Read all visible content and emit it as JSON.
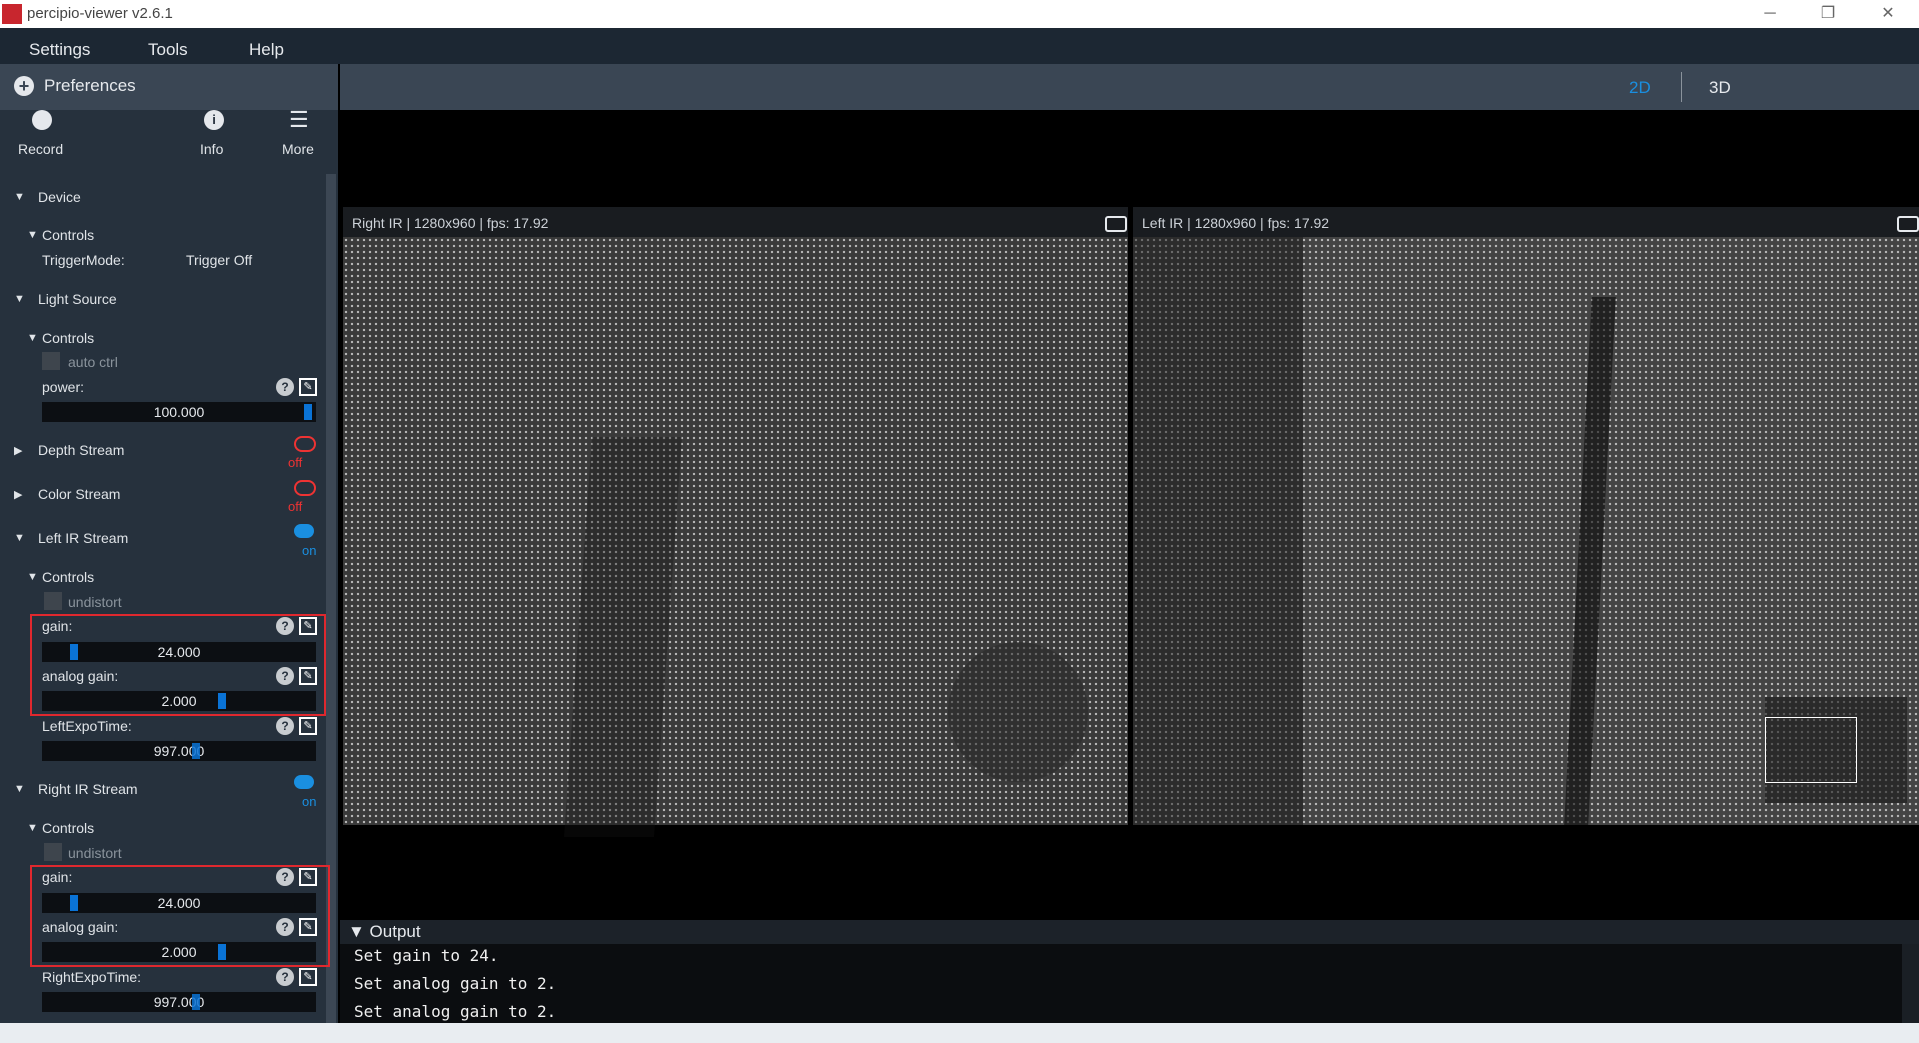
{
  "window": {
    "title": "percipio-viewer v2.6.1",
    "minimize": "─",
    "restore": "❐",
    "close": "✕"
  },
  "menu": {
    "settings": "Settings",
    "tools": "Tools",
    "help": "Help"
  },
  "sidebar": {
    "preferences": "Preferences",
    "plus": "+",
    "record": "Record",
    "info": "Info",
    "info_glyph": "i",
    "more": "More",
    "more_glyph": "☰",
    "device": "Device",
    "controls": "Controls",
    "trigger_mode_label": "TriggerMode:",
    "trigger_mode_value": "Trigger Off",
    "light_source": "Light Source",
    "auto_ctrl": "auto ctrl",
    "power_label": "power:",
    "power_value": "100.000",
    "power_level": 1.0,
    "depth_stream": "Depth Stream",
    "depth_status": "off",
    "color_stream": "Color Stream",
    "color_status": "off",
    "left_ir": "Left IR Stream",
    "left_status": "on",
    "undistort": "undistort",
    "gain_label": "gain:",
    "gain_value": "24.000",
    "analog_gain_label": "analog gain:",
    "analog_gain_value": "2.000",
    "left_expo_label": "LeftExpoTime:",
    "expo_value": "997.000",
    "right_ir": "Right IR Stream",
    "right_status": "on",
    "right_expo_label": "RightExpoTime:",
    "help_glyph": "?",
    "edit_glyph": "✎"
  },
  "view_tabs": {
    "tab_2d": "2D",
    "tab_3d": "3D"
  },
  "panels": {
    "right": "Right IR | 1280x960 | fps: 17.92",
    "left": "Left IR | 1280x960 | fps: 17.92"
  },
  "output": {
    "title": "▼ Output",
    "lines": [
      "Set gain to 24.",
      "Set analog gain to 2.",
      "Set analog gain to 2."
    ]
  },
  "colors": {
    "accent": "#1a8fe0",
    "highlight_box": "#e0282e",
    "off": "#e33333",
    "sidebar_bg": "#26313d",
    "header_bg": "#3a4654"
  }
}
